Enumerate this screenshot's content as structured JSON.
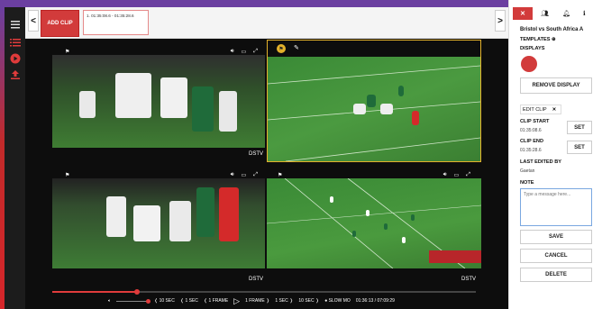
{
  "topbar": {
    "add_clip_label": "ADD CLIP",
    "clip_entry": "1. 01:35:08.6 - 01:35:28.6",
    "prev_label": "<",
    "next_label": ">"
  },
  "videos": [
    {
      "id": "tl",
      "label": "DSTV",
      "active": false
    },
    {
      "id": "tr",
      "label": "",
      "active": true
    },
    {
      "id": "bl",
      "label": "DSTV",
      "active": false
    },
    {
      "id": "br",
      "label": "DSTV",
      "active": false
    }
  ],
  "playback": {
    "progress": 0.2,
    "back_10": "10 SEC",
    "back_1": "1 SEC",
    "back_frame": "1 FRAME",
    "fwd_frame": "1 FRAME",
    "fwd_1": "1 SEC",
    "fwd_10": "10 SEC",
    "slow_mo": "SLOW MO",
    "time": "01:36:13 / 07:09:29"
  },
  "panel": {
    "match_title": "Bristol vs South Africa A",
    "templates_label": "TEMPLATES",
    "displays_label": "DISPLAYS",
    "remove_display": "REMOVE DISPLAY",
    "edit_clip": "EDIT CLIP",
    "clip_start_label": "CLIP START",
    "clip_start_val": "01:35:08.6",
    "clip_end_label": "CLIP END",
    "clip_end_val": "01:35:28.6",
    "set_label": "SET",
    "last_edited_label": "LAST EDITED BY",
    "last_edited_val": "Gaetan",
    "note_label": "NOTE",
    "note_placeholder": "Type a message here...",
    "save": "SAVE",
    "cancel": "CANCEL",
    "delete": "DELETE",
    "close_glyph": "✕"
  },
  "colors": {
    "accent_red": "#d23b3b",
    "active_border": "#e3b12b",
    "pitch_green": "#3f8a3a",
    "purple_top": "#6b3fa0"
  }
}
